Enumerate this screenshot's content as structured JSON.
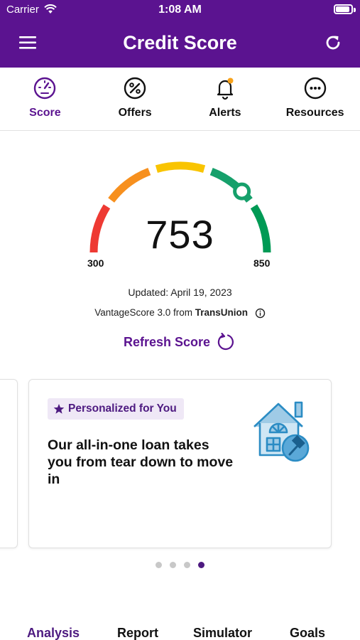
{
  "status_bar": {
    "carrier": "Carrier",
    "time": "1:08 AM"
  },
  "header": {
    "title": "Credit Score",
    "menu_icon": "hamburger-icon",
    "refresh_icon": "refresh-icon",
    "background": "#5b1390"
  },
  "tabs": [
    {
      "label": "Score",
      "icon": "speedometer-icon",
      "active": true
    },
    {
      "label": "Offers",
      "icon": "percent-icon",
      "active": false
    },
    {
      "label": "Alerts",
      "icon": "bell-icon",
      "active": false,
      "has_notification_dot": true
    },
    {
      "label": "Resources",
      "icon": "more-dots-icon",
      "active": false
    }
  ],
  "score": {
    "value": "753",
    "min": "300",
    "max": "850",
    "updated": "Updated: April 19, 2023",
    "source_prefix": "VantageScore 3.0 from ",
    "source_bureau": "TransUnion",
    "refresh_label": "Refresh Score",
    "gauge_colors": [
      "#ee3a33",
      "#f7901e",
      "#f9c400",
      "#16a06b",
      "#009a55"
    ]
  },
  "promo_card": {
    "badge": "Personalized for You",
    "text": "Our all-in-one loan takes you from tear down to move in",
    "illustration": "house-hammer-icon"
  },
  "carousel": {
    "page_count": 4,
    "active_index": 3
  },
  "bottom_tabs": [
    {
      "label": "Analysis",
      "active": true
    },
    {
      "label": "Report",
      "active": false
    },
    {
      "label": "Simulator",
      "active": false
    },
    {
      "label": "Goals",
      "active": false
    }
  ],
  "colors": {
    "brand_purple": "#5b1390",
    "badge_bg": "#efe8f6"
  }
}
